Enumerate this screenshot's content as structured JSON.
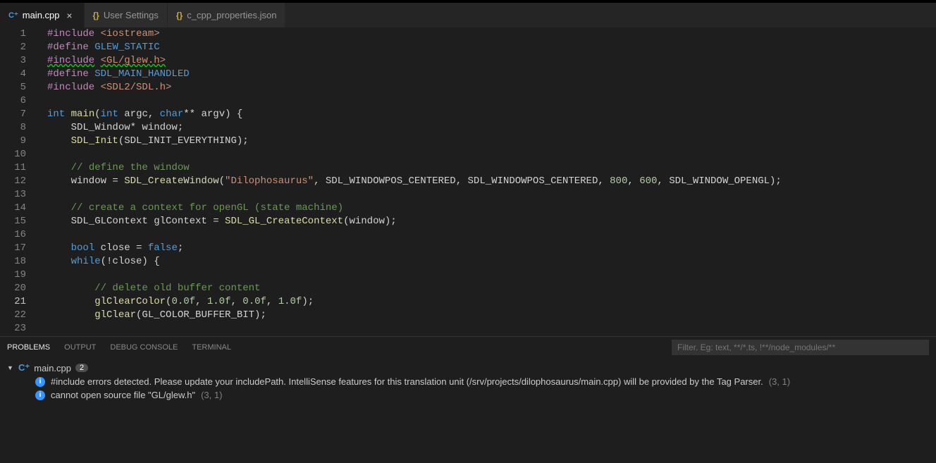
{
  "tabs": [
    {
      "label": "main.cpp",
      "iconType": "cpp",
      "active": true
    },
    {
      "label": "User Settings",
      "iconType": "json",
      "active": false
    },
    {
      "label": "c_cpp_properties.json",
      "iconType": "json",
      "active": false
    }
  ],
  "editor": {
    "currentLine": 21,
    "lines": [
      {
        "n": 1,
        "indent": 0,
        "tokens": [
          [
            "tok-pp",
            "#include"
          ],
          [
            "tok-id",
            " "
          ],
          [
            "tok-incb",
            "<iostream>"
          ]
        ]
      },
      {
        "n": 2,
        "indent": 0,
        "tokens": [
          [
            "tok-pp",
            "#define"
          ],
          [
            "tok-id",
            " "
          ],
          [
            "tok-def",
            "GLEW_STATIC"
          ]
        ]
      },
      {
        "n": 3,
        "indent": 0,
        "tokens": [
          [
            "tok-pp squiggle",
            "#include"
          ],
          [
            "tok-id",
            " "
          ],
          [
            "tok-incb squiggle",
            "<GL/glew.h>"
          ]
        ]
      },
      {
        "n": 4,
        "indent": 0,
        "tokens": [
          [
            "tok-pp",
            "#define"
          ],
          [
            "tok-id",
            " "
          ],
          [
            "tok-def",
            "SDL_MAIN_HANDLED"
          ]
        ]
      },
      {
        "n": 5,
        "indent": 0,
        "tokens": [
          [
            "tok-pp",
            "#include"
          ],
          [
            "tok-id",
            " "
          ],
          [
            "tok-incb",
            "<SDL2/SDL.h>"
          ]
        ]
      },
      {
        "n": 6,
        "indent": 0,
        "tokens": []
      },
      {
        "n": 7,
        "indent": 0,
        "tokens": [
          [
            "tok-kw",
            "int"
          ],
          [
            "tok-id",
            " "
          ],
          [
            "tok-fn",
            "main"
          ],
          [
            "tok-id",
            "("
          ],
          [
            "tok-kw",
            "int"
          ],
          [
            "tok-id",
            " argc, "
          ],
          [
            "tok-kw",
            "char"
          ],
          [
            "tok-id",
            "** argv) {"
          ]
        ]
      },
      {
        "n": 8,
        "indent": 1,
        "tokens": [
          [
            "tok-id",
            "    SDL_Window* window;"
          ]
        ]
      },
      {
        "n": 9,
        "indent": 1,
        "tokens": [
          [
            "tok-id",
            "    "
          ],
          [
            "tok-fn",
            "SDL_Init"
          ],
          [
            "tok-id",
            "(SDL_INIT_EVERYTHING);"
          ]
        ]
      },
      {
        "n": 10,
        "indent": 1,
        "tokens": []
      },
      {
        "n": 11,
        "indent": 1,
        "tokens": [
          [
            "tok-id",
            "    "
          ],
          [
            "tok-cmt",
            "// define the window"
          ]
        ]
      },
      {
        "n": 12,
        "indent": 1,
        "tokens": [
          [
            "tok-id",
            "    window = "
          ],
          [
            "tok-fn",
            "SDL_CreateWindow"
          ],
          [
            "tok-id",
            "("
          ],
          [
            "tok-str",
            "\"Dilophosaurus\""
          ],
          [
            "tok-id",
            ", SDL_WINDOWPOS_CENTERED, SDL_WINDOWPOS_CENTERED, "
          ],
          [
            "tok-num",
            "800"
          ],
          [
            "tok-id",
            ", "
          ],
          [
            "tok-num",
            "600"
          ],
          [
            "tok-id",
            ", SDL_WINDOW_OPENGL);"
          ]
        ]
      },
      {
        "n": 13,
        "indent": 1,
        "tokens": []
      },
      {
        "n": 14,
        "indent": 1,
        "tokens": [
          [
            "tok-id",
            "    "
          ],
          [
            "tok-cmt",
            "// create a context for openGL (state machine)"
          ]
        ]
      },
      {
        "n": 15,
        "indent": 1,
        "tokens": [
          [
            "tok-id",
            "    SDL_GLContext glContext = "
          ],
          [
            "tok-fn",
            "SDL_GL_CreateContext"
          ],
          [
            "tok-id",
            "(window);"
          ]
        ]
      },
      {
        "n": 16,
        "indent": 1,
        "tokens": []
      },
      {
        "n": 17,
        "indent": 1,
        "tokens": [
          [
            "tok-id",
            "    "
          ],
          [
            "tok-kw",
            "bool"
          ],
          [
            "tok-id",
            " close = "
          ],
          [
            "tok-kw",
            "false"
          ],
          [
            "tok-id",
            ";"
          ]
        ]
      },
      {
        "n": 18,
        "indent": 1,
        "tokens": [
          [
            "tok-id",
            "    "
          ],
          [
            "tok-kw",
            "while"
          ],
          [
            "tok-id",
            "(!close) {"
          ]
        ]
      },
      {
        "n": 19,
        "indent": 2,
        "tokens": []
      },
      {
        "n": 20,
        "indent": 2,
        "tokens": [
          [
            "tok-id",
            "        "
          ],
          [
            "tok-cmt",
            "// delete old buffer content"
          ]
        ]
      },
      {
        "n": 21,
        "indent": 2,
        "tokens": [
          [
            "tok-id",
            "        "
          ],
          [
            "tok-fn",
            "glClearColor"
          ],
          [
            "tok-id",
            "("
          ],
          [
            "tok-flt",
            "0.0f"
          ],
          [
            "tok-id",
            ", "
          ],
          [
            "tok-flt",
            "1.0f"
          ],
          [
            "tok-id",
            ", "
          ],
          [
            "tok-flt",
            "0.0f"
          ],
          [
            "tok-id",
            ", "
          ],
          [
            "tok-flt",
            "1.0f"
          ],
          [
            "tok-id",
            ");"
          ]
        ]
      },
      {
        "n": 22,
        "indent": 2,
        "tokens": [
          [
            "tok-id",
            "        "
          ],
          [
            "tok-fn",
            "glClear"
          ],
          [
            "tok-id",
            "(GL_COLOR_BUFFER_BIT);"
          ]
        ]
      },
      {
        "n": 23,
        "indent": 2,
        "tokens": []
      }
    ]
  },
  "panel": {
    "tabs": [
      "PROBLEMS",
      "OUTPUT",
      "DEBUG CONSOLE",
      "TERMINAL"
    ],
    "activeTab": 0,
    "filterPlaceholder": "Filter. Eg: text, **/*.ts, !**/node_modules/**",
    "file": {
      "name": "main.cpp",
      "count": "2"
    },
    "problems": [
      {
        "msg": "#include errors detected. Please update your includePath. IntelliSense features for this translation unit (/srv/projects/dilophosaurus/main.cpp) will be provided by the Tag Parser.",
        "loc": "(3, 1)"
      },
      {
        "msg": "cannot open source file \"GL/glew.h\"",
        "loc": "(3, 1)"
      }
    ]
  }
}
